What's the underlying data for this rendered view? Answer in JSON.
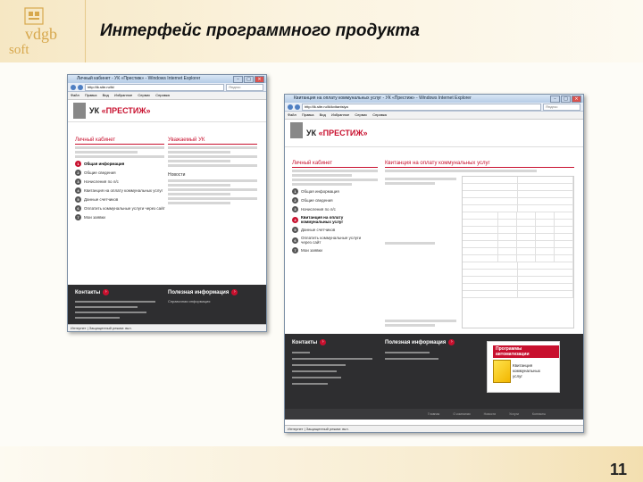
{
  "slide": {
    "title": "Интерфейс программного продукта",
    "page_number": "11",
    "logo": {
      "line1": "vdgb",
      "line2": "soft",
      "colors": {
        "brand": "#d7a84d"
      }
    }
  },
  "back_window": {
    "title": "Личный кабинет - УК «Престиж» - Windows Internet Explorer",
    "address": "http://lk.site.ru/lk/",
    "search_placeholder": "Яндекс",
    "menu": [
      "Файл",
      "Правка",
      "Вид",
      "Избранное",
      "Сервис",
      "Справка"
    ],
    "site": {
      "brand_prefix": "УК ",
      "brand_name": "«ПРЕСТИЖ»"
    },
    "left_col_title": "Личный кабинет",
    "middle_col_title": "Уважаемый УК",
    "menu_items": [
      {
        "num": "1",
        "label": "Общая информация",
        "active": true
      },
      {
        "num": "2",
        "label": "Общие сведения"
      },
      {
        "num": "3",
        "label": "Начисления по л/с"
      },
      {
        "num": "4",
        "label": "Квитанция на оплату коммунальных услуг"
      },
      {
        "num": "5",
        "label": "Данные счетчиков"
      },
      {
        "num": "6",
        "label": "Оплатить коммунальные услуги через сайт"
      },
      {
        "num": "7",
        "label": "Мои заявки"
      }
    ],
    "middle_link": "Новости",
    "footer": {
      "contacts": "Контакты",
      "useful": "Полезная информация",
      "link": "Справочная информация"
    },
    "status": "Интернет | Защищенный режим: вкл."
  },
  "front_window": {
    "title": "Квитанция на оплату коммунальных услуг - УК «Престиж» - Windows Internet Explorer",
    "address": "http://lk.site.ru/lk/kvitantsiya",
    "search_placeholder": "Яндекс",
    "menu": [
      "Файл",
      "Правка",
      "Вид",
      "Избранное",
      "Сервис",
      "Справка"
    ],
    "site": {
      "brand_prefix": "УК ",
      "brand_name": "«ПРЕСТИЖ»"
    },
    "left_col_title": "Личный кабинет",
    "main_col_title": "Квитанция на оплату коммунальных услуг",
    "menu_items": [
      {
        "num": "1",
        "label": "Общая информация"
      },
      {
        "num": "2",
        "label": "Общие сведения"
      },
      {
        "num": "3",
        "label": "Начисления по л/с"
      },
      {
        "num": "4",
        "label": "Квитанция на оплату коммунальных услуг",
        "active": true
      },
      {
        "num": "5",
        "label": "Данные счетчиков"
      },
      {
        "num": "6",
        "label": "Оплатить коммунальные услуги через сайт"
      },
      {
        "num": "7",
        "label": "Мои заявки"
      }
    ],
    "footer": {
      "contacts": "Контакты",
      "useful": "Полезная информация",
      "nav": [
        "Главная",
        "О компании",
        "Новости",
        "Услуги",
        "Контакты"
      ]
    },
    "promo": {
      "title": "Программы автоматизации",
      "text": "Квитанция коммунальных услуг"
    },
    "status": "Интернет | Защищенный режим: вкл."
  }
}
